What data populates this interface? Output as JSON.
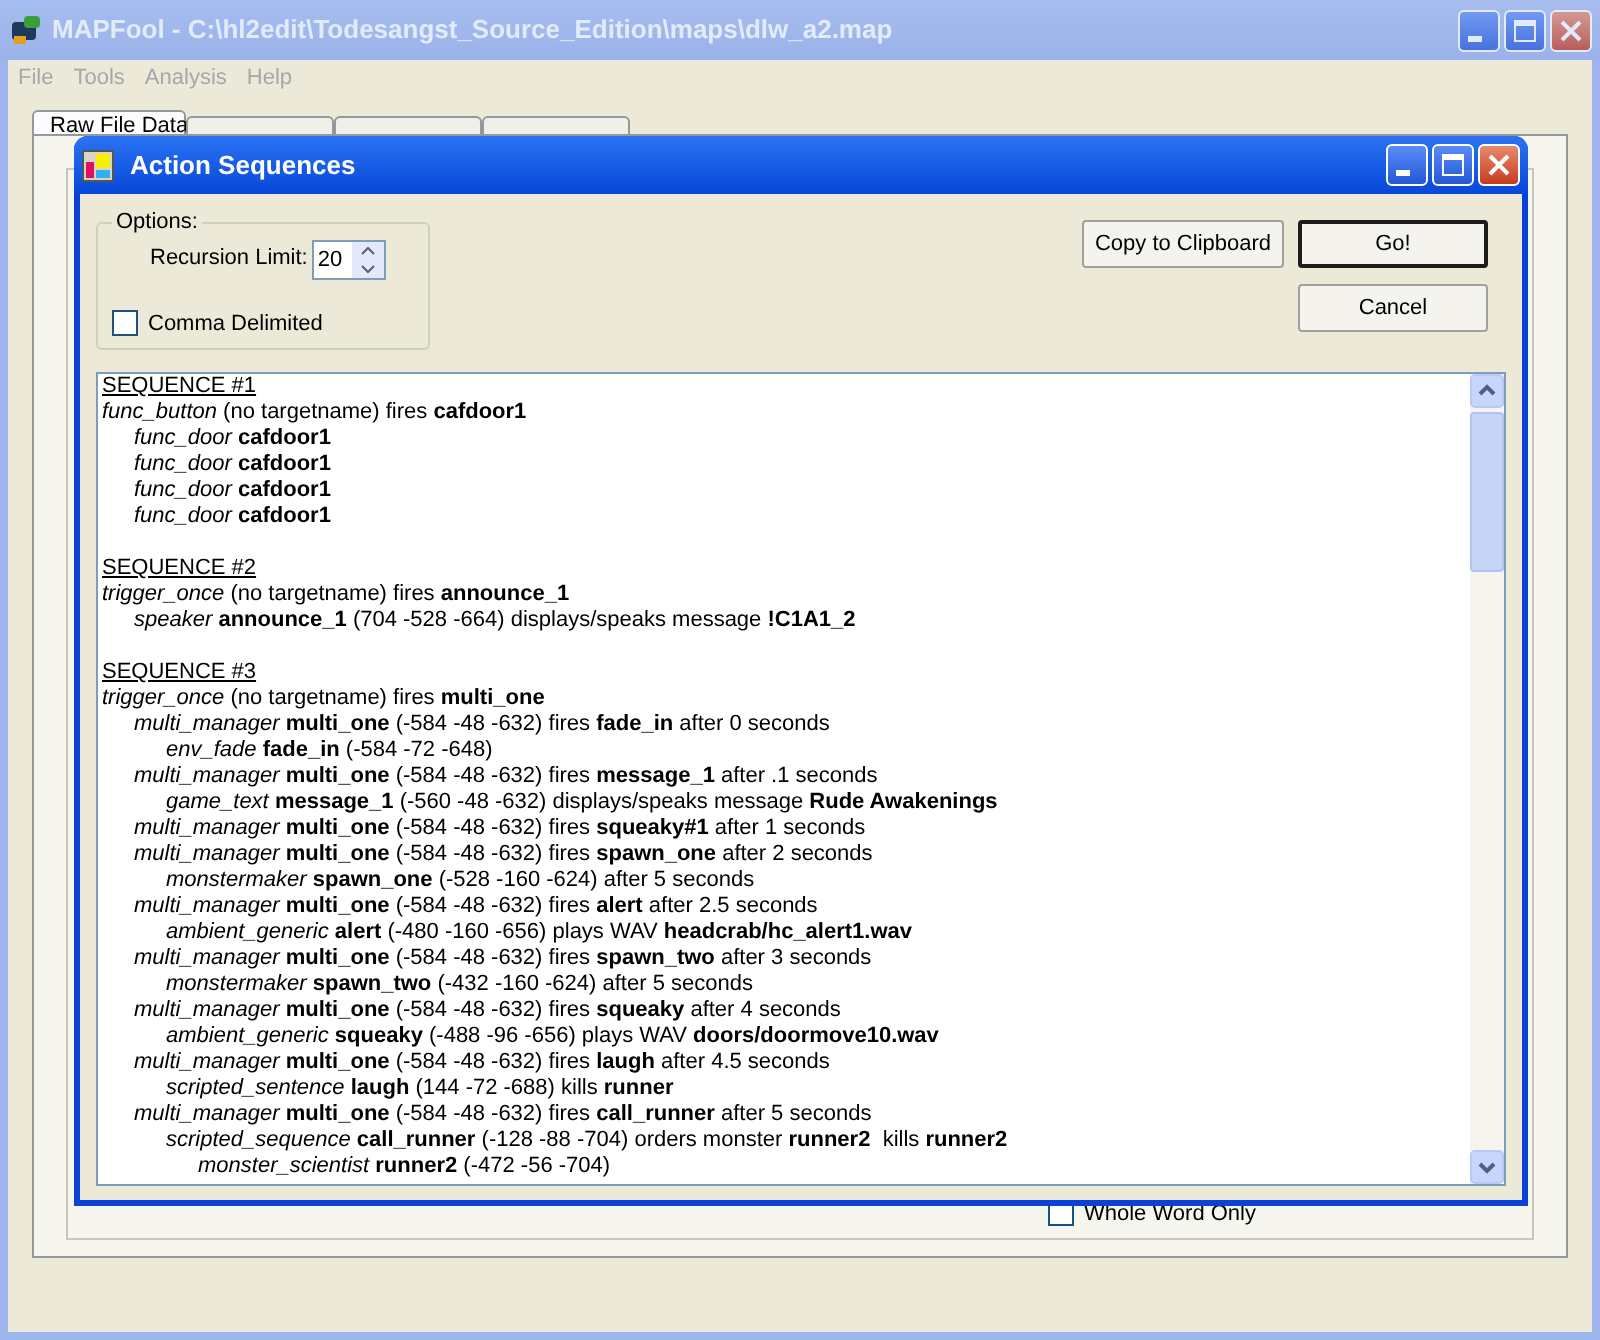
{
  "main_window": {
    "title": "MAPFool - C:\\hl2edit\\Todesangst_Source_Edition\\maps\\dlw_a2.map"
  },
  "menu": [
    "File",
    "Tools",
    "Analysis",
    "Help"
  ],
  "tabs": [
    {
      "label": "Raw File Data",
      "selected": true
    },
    {
      "selected": false
    },
    {
      "selected": false
    },
    {
      "selected": false
    }
  ],
  "whole_word_only": {
    "label": "Whole Word Only",
    "checked": false
  },
  "dialog": {
    "title": "Action Sequences",
    "options": {
      "legend": "Options:",
      "recursion_limit": {
        "label": "Recursion Limit:",
        "value": "20"
      },
      "comma_delimited": {
        "label": "Comma Delimited",
        "checked": false
      }
    },
    "buttons": [
      {
        "label": "Copy to Clipboard",
        "default": false
      },
      {
        "label": "Go!",
        "default": true
      },
      {
        "label": "Cancel",
        "default": false
      }
    ],
    "sequences": [
      {
        "title": "SEQUENCE #1",
        "lines": [
          {
            "text": "*func_button* (no targetname) fires **cafdoor1**",
            "children": [
              {
                "text": "*func_door* **cafdoor1**"
              },
              {
                "text": "*func_door* **cafdoor1**"
              },
              {
                "text": "*func_door* **cafdoor1**"
              },
              {
                "text": "*func_door* **cafdoor1**"
              }
            ]
          }
        ]
      },
      {
        "title": "SEQUENCE #2",
        "lines": [
          {
            "text": "*trigger_once* (no targetname) fires **announce_1**",
            "children": [
              {
                "text": "*speaker* **announce_1** (704 -528 -664) displays/speaks message **!C1A1_2**"
              }
            ]
          }
        ]
      },
      {
        "title": "SEQUENCE #3",
        "lines": [
          {
            "text": "*trigger_once* (no targetname) fires **multi_one**",
            "children": [
              {
                "text": "*multi_manager* **multi_one** (-584 -48 -632) fires **fade_in** after 0 seconds",
                "children": [
                  {
                    "text": "*env_fade* **fade_in** (-584 -72 -648)"
                  }
                ]
              },
              {
                "text": "*multi_manager* **multi_one** (-584 -48 -632) fires **message_1** after .1 seconds",
                "children": [
                  {
                    "text": "*game_text* **message_1** (-560 -48 -632) displays/speaks message **Rude Awakenings**"
                  }
                ]
              },
              {
                "text": "*multi_manager* **multi_one** (-584 -48 -632) fires **squeaky#1** after 1 seconds"
              },
              {
                "text": "*multi_manager* **multi_one** (-584 -48 -632) fires **spawn_one** after 2 seconds",
                "children": [
                  {
                    "text": "*monstermaker* **spawn_one** (-528 -160 -624) after 5 seconds"
                  }
                ]
              },
              {
                "text": "*multi_manager* **multi_one** (-584 -48 -632) fires **alert** after 2.5 seconds",
                "children": [
                  {
                    "text": "*ambient_generic* **alert** (-480 -160 -656) plays WAV **headcrab/hc_alert1.wav**"
                  }
                ]
              },
              {
                "text": "*multi_manager* **multi_one** (-584 -48 -632) fires **spawn_two** after 3 seconds",
                "children": [
                  {
                    "text": "*monstermaker* **spawn_two** (-432 -160 -624) after 5 seconds"
                  }
                ]
              },
              {
                "text": "*multi_manager* **multi_one** (-584 -48 -632) fires **squeaky** after 4 seconds",
                "children": [
                  {
                    "text": "*ambient_generic* **squeaky** (-488 -96 -656) plays WAV **doors/doormove10.wav**"
                  }
                ]
              },
              {
                "text": "*multi_manager* **multi_one** (-584 -48 -632) fires **laugh** after 4.5 seconds",
                "children": [
                  {
                    "text": "*scripted_sentence* **laugh** (144 -72 -688) kills **runner**"
                  }
                ]
              },
              {
                "text": "*multi_manager* **multi_one** (-584 -48 -632) fires **call_runner** after 5 seconds",
                "children": [
                  {
                    "text": "*scripted_sequence* **call_runner** (-128 -88 -704) orders monster **runner2**  kills **runner2**",
                    "children": [
                      {
                        "text": "*monster_scientist* **runner2** (-472 -56 -704)"
                      }
                    ]
                  }
                ]
              }
            ]
          }
        ]
      }
    ]
  }
}
